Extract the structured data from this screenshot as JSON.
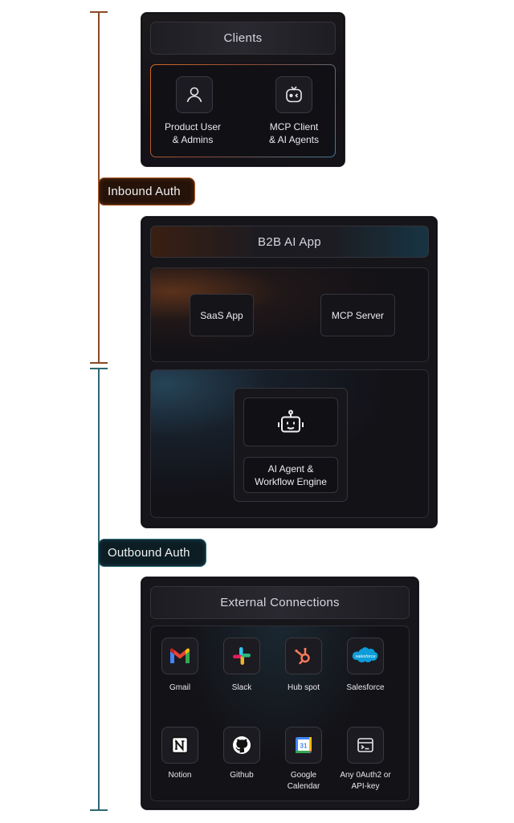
{
  "labels": {
    "inbound_auth": "Inbound Auth",
    "outbound_auth": "Outbound Auth"
  },
  "clients": {
    "title": "Clients",
    "items": [
      {
        "label": "Product User\n& Admins",
        "icon": "user-icon"
      },
      {
        "label": "MCP Client\n& AI Agents",
        "icon": "robot-face-icon"
      }
    ]
  },
  "b2b_app": {
    "title": "B2B AI App",
    "services": [
      "SaaS App",
      "MCP Server"
    ],
    "agent": {
      "label": "AI Agent &\nWorkflow Engine",
      "icon": "robot-icon"
    }
  },
  "external": {
    "title": "External Connections",
    "connections": [
      {
        "label": "Gmail",
        "icon": "gmail-icon"
      },
      {
        "label": "Slack",
        "icon": "slack-icon"
      },
      {
        "label": "Hub spot",
        "icon": "hubspot-icon"
      },
      {
        "label": "Salesforce",
        "icon": "salesforce-icon",
        "logo_text": "salesforce"
      },
      {
        "label": "Notion",
        "icon": "notion-icon"
      },
      {
        "label": "Github",
        "icon": "github-icon"
      },
      {
        "label": "Google\nCalendar",
        "icon": "google-calendar-icon",
        "logo_text": "31"
      },
      {
        "label": "Any 0Auth2 or\nAPI-key",
        "icon": "terminal-window-icon"
      }
    ]
  },
  "colors": {
    "inbound": "#b15d2a",
    "outbound": "#2b6977",
    "panel": "#16151a"
  }
}
